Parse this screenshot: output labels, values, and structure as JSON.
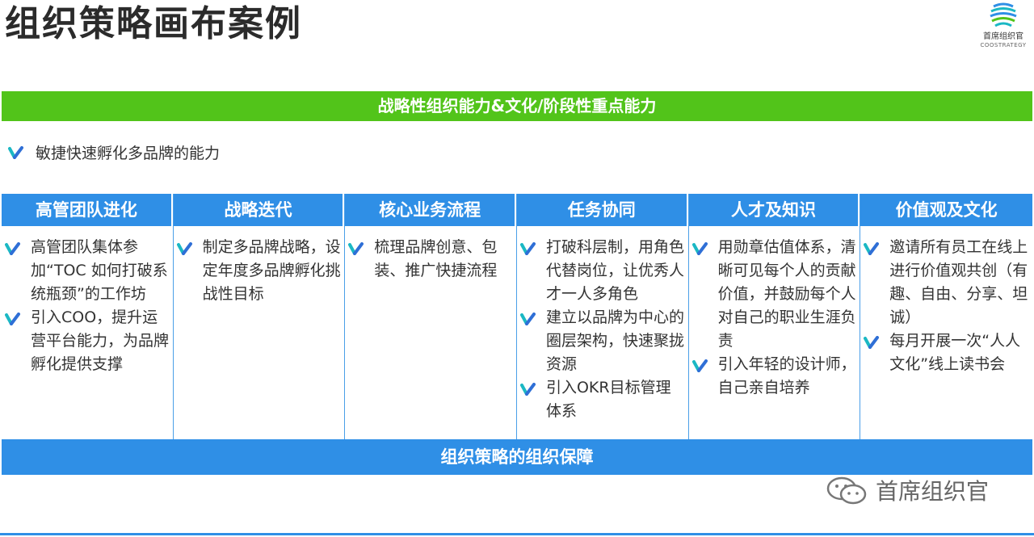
{
  "title": "组织策略画布案例",
  "logo": {
    "cn": "首席组织官",
    "en": "COOSTRATEGY"
  },
  "green_bar": "战略性组织能力&文化/阶段性重点能力",
  "headline": "敏捷快速孵化多品牌的能力",
  "columns": [
    {
      "title": "高管团队进化",
      "items": [
        "高管团队集体参加“TOC 如何打破系统瓶颈”的工作坊",
        "引入COO，提升运营平台能力，为品牌孵化提供支撑"
      ]
    },
    {
      "title": "战略迭代",
      "items": [
        "制定多品牌战略，设定年度多品牌孵化挑战性目标"
      ]
    },
    {
      "title": "核心业务流程",
      "items": [
        "梳理品牌创意、包装、推广快捷流程"
      ]
    },
    {
      "title": "任务协同",
      "items": [
        "打破科层制，用角色代替岗位，让优秀人才一人多角色",
        "建立以品牌为中心的圈层架构，快速聚拢资源",
        "引入OKR目标管理体系"
      ]
    },
    {
      "title": "人才及知识",
      "items": [
        "用勋章估值体系，清晰可见每个人的贡献价值，并鼓励每个人对自己的职业生涯负责",
        "引入年轻的设计师，自己亲自培养"
      ]
    },
    {
      "title": "价值观及文化",
      "items": [
        "邀请所有员工在线上进行价值观共创（有趣、自由、分享、坦诚）",
        "每月开展一次“人人文化”线上读书会"
      ]
    }
  ],
  "blue_bar": "组织策略的组织保障",
  "watermark": "首席组织官",
  "colors": {
    "green": "#52c41a",
    "blue": "#2f8fe6",
    "check_teal": "#1bb8c4",
    "check_blue": "#2f6fd6"
  }
}
